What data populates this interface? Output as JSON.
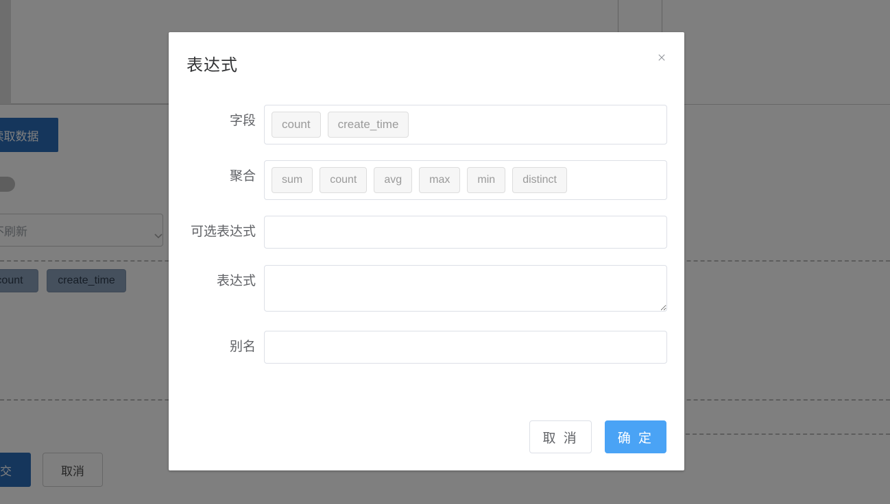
{
  "background": {
    "read_data_button": "读取数据",
    "refresh_select_value": "默认不刷新",
    "chips": [
      "count",
      "create_time"
    ],
    "submit_button": "提交",
    "cancel_button": "取消"
  },
  "modal": {
    "title": "表达式",
    "close_icon": "close-icon",
    "rows": {
      "field": {
        "label": "字段",
        "options": [
          "count",
          "create_time"
        ]
      },
      "aggregate": {
        "label": "聚合",
        "options": [
          "sum",
          "count",
          "avg",
          "max",
          "min",
          "distinct"
        ]
      },
      "optional_expression": {
        "label": "可选表达式",
        "value": "",
        "placeholder": ""
      },
      "expression": {
        "label": "表达式",
        "value": "",
        "placeholder": ""
      },
      "alias": {
        "label": "别名",
        "value": "",
        "placeholder": ""
      }
    },
    "footer": {
      "cancel": "取 消",
      "confirm": "确 定"
    }
  },
  "colors": {
    "primary": "#4aa3f5",
    "background_primary": "#2b6cb8",
    "overlay": "rgba(0,0,0,0.5)",
    "border": "#dcdfe6",
    "text": "#606266"
  }
}
